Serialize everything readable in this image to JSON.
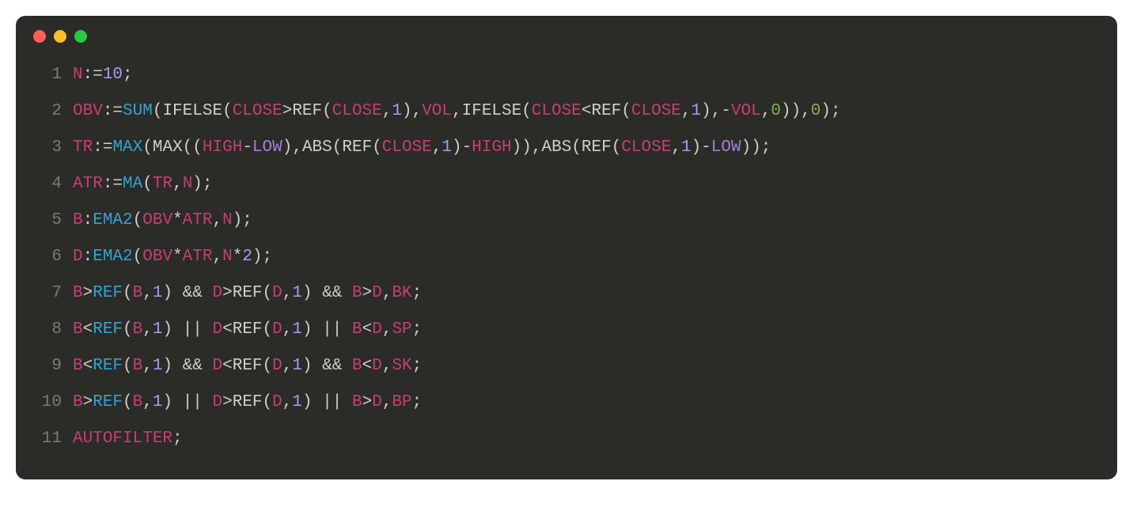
{
  "window": {
    "dots": [
      "red",
      "yellow",
      "green"
    ]
  },
  "lines": [
    {
      "n": "1",
      "tokens": [
        {
          "c": "t-var",
          "t": "N"
        },
        {
          "c": "t-punct",
          "t": ":="
        },
        {
          "c": "t-num",
          "t": "10"
        },
        {
          "c": "t-punct",
          "t": ";"
        }
      ]
    },
    {
      "n": "2",
      "tokens": [
        {
          "c": "t-var",
          "t": "OBV"
        },
        {
          "c": "t-punct",
          "t": ":="
        },
        {
          "c": "t-func",
          "t": "SUM"
        },
        {
          "c": "t-punct",
          "t": "("
        },
        {
          "c": "t-default",
          "t": "IFELSE"
        },
        {
          "c": "t-punct",
          "t": "("
        },
        {
          "c": "t-var",
          "t": "CLOSE"
        },
        {
          "c": "t-punct",
          "t": ">"
        },
        {
          "c": "t-default",
          "t": "REF"
        },
        {
          "c": "t-punct",
          "t": "("
        },
        {
          "c": "t-var",
          "t": "CLOSE"
        },
        {
          "c": "t-punct",
          "t": ","
        },
        {
          "c": "t-num",
          "t": "1"
        },
        {
          "c": "t-punct",
          "t": "),"
        },
        {
          "c": "t-var",
          "t": "VOL"
        },
        {
          "c": "t-punct",
          "t": ","
        },
        {
          "c": "t-default",
          "t": "IFELSE"
        },
        {
          "c": "t-punct",
          "t": "("
        },
        {
          "c": "t-var",
          "t": "CLOSE"
        },
        {
          "c": "t-punct",
          "t": "<"
        },
        {
          "c": "t-default",
          "t": "REF"
        },
        {
          "c": "t-punct",
          "t": "("
        },
        {
          "c": "t-var",
          "t": "CLOSE"
        },
        {
          "c": "t-punct",
          "t": ","
        },
        {
          "c": "t-num",
          "t": "1"
        },
        {
          "c": "t-punct",
          "t": "),-"
        },
        {
          "c": "t-var",
          "t": "VOL"
        },
        {
          "c": "t-punct",
          "t": ","
        },
        {
          "c": "t-green",
          "t": "0"
        },
        {
          "c": "t-punct",
          "t": ")),"
        },
        {
          "c": "t-green",
          "t": "0"
        },
        {
          "c": "t-punct",
          "t": ");"
        }
      ]
    },
    {
      "n": "3",
      "tokens": [
        {
          "c": "t-var",
          "t": "TR"
        },
        {
          "c": "t-punct",
          "t": ":="
        },
        {
          "c": "t-func",
          "t": "MAX"
        },
        {
          "c": "t-punct",
          "t": "("
        },
        {
          "c": "t-default",
          "t": "MAX"
        },
        {
          "c": "t-punct",
          "t": "(("
        },
        {
          "c": "t-var",
          "t": "HIGH"
        },
        {
          "c": "t-punct",
          "t": "-"
        },
        {
          "c": "t-kw",
          "t": "LOW"
        },
        {
          "c": "t-punct",
          "t": "),"
        },
        {
          "c": "t-default",
          "t": "ABS"
        },
        {
          "c": "t-punct",
          "t": "("
        },
        {
          "c": "t-default",
          "t": "REF"
        },
        {
          "c": "t-punct",
          "t": "("
        },
        {
          "c": "t-var",
          "t": "CLOSE"
        },
        {
          "c": "t-punct",
          "t": ","
        },
        {
          "c": "t-num",
          "t": "1"
        },
        {
          "c": "t-punct",
          "t": ")-"
        },
        {
          "c": "t-var",
          "t": "HIGH"
        },
        {
          "c": "t-punct",
          "t": ")),"
        },
        {
          "c": "t-default",
          "t": "ABS"
        },
        {
          "c": "t-punct",
          "t": "("
        },
        {
          "c": "t-default",
          "t": "REF"
        },
        {
          "c": "t-punct",
          "t": "("
        },
        {
          "c": "t-var",
          "t": "CLOSE"
        },
        {
          "c": "t-punct",
          "t": ","
        },
        {
          "c": "t-num",
          "t": "1"
        },
        {
          "c": "t-punct",
          "t": ")-"
        },
        {
          "c": "t-kw",
          "t": "LOW"
        },
        {
          "c": "t-punct",
          "t": "));"
        }
      ]
    },
    {
      "n": "4",
      "tokens": [
        {
          "c": "t-var",
          "t": "ATR"
        },
        {
          "c": "t-punct",
          "t": ":="
        },
        {
          "c": "t-func",
          "t": "MA"
        },
        {
          "c": "t-punct",
          "t": "("
        },
        {
          "c": "t-var",
          "t": "TR"
        },
        {
          "c": "t-punct",
          "t": ","
        },
        {
          "c": "t-var",
          "t": "N"
        },
        {
          "c": "t-punct",
          "t": ");"
        }
      ]
    },
    {
      "n": "5",
      "tokens": [
        {
          "c": "t-var",
          "t": "B"
        },
        {
          "c": "t-punct",
          "t": ":"
        },
        {
          "c": "t-func",
          "t": "EMA2"
        },
        {
          "c": "t-punct",
          "t": "("
        },
        {
          "c": "t-var",
          "t": "OBV"
        },
        {
          "c": "t-punct",
          "t": "*"
        },
        {
          "c": "t-var",
          "t": "ATR"
        },
        {
          "c": "t-punct",
          "t": ","
        },
        {
          "c": "t-var",
          "t": "N"
        },
        {
          "c": "t-punct",
          "t": ");"
        }
      ]
    },
    {
      "n": "6",
      "tokens": [
        {
          "c": "t-var",
          "t": "D"
        },
        {
          "c": "t-punct",
          "t": ":"
        },
        {
          "c": "t-func",
          "t": "EMA2"
        },
        {
          "c": "t-punct",
          "t": "("
        },
        {
          "c": "t-var",
          "t": "OBV"
        },
        {
          "c": "t-punct",
          "t": "*"
        },
        {
          "c": "t-var",
          "t": "ATR"
        },
        {
          "c": "t-punct",
          "t": ","
        },
        {
          "c": "t-var",
          "t": "N"
        },
        {
          "c": "t-punct",
          "t": "*"
        },
        {
          "c": "t-num",
          "t": "2"
        },
        {
          "c": "t-punct",
          "t": ");"
        }
      ]
    },
    {
      "n": "7",
      "tokens": [
        {
          "c": "t-var",
          "t": "B"
        },
        {
          "c": "t-punct",
          "t": ">"
        },
        {
          "c": "t-func",
          "t": "REF"
        },
        {
          "c": "t-punct",
          "t": "("
        },
        {
          "c": "t-var",
          "t": "B"
        },
        {
          "c": "t-punct",
          "t": ","
        },
        {
          "c": "t-num",
          "t": "1"
        },
        {
          "c": "t-punct",
          "t": ") "
        },
        {
          "c": "t-punct",
          "t": "&& "
        },
        {
          "c": "t-var",
          "t": "D"
        },
        {
          "c": "t-punct",
          "t": ">"
        },
        {
          "c": "t-default",
          "t": "REF"
        },
        {
          "c": "t-punct",
          "t": "("
        },
        {
          "c": "t-var",
          "t": "D"
        },
        {
          "c": "t-punct",
          "t": ","
        },
        {
          "c": "t-num",
          "t": "1"
        },
        {
          "c": "t-punct",
          "t": ") "
        },
        {
          "c": "t-punct",
          "t": "&& "
        },
        {
          "c": "t-var",
          "t": "B"
        },
        {
          "c": "t-punct",
          "t": ">"
        },
        {
          "c": "t-var",
          "t": "D"
        },
        {
          "c": "t-punct",
          "t": ","
        },
        {
          "c": "t-var",
          "t": "BK"
        },
        {
          "c": "t-punct",
          "t": ";"
        }
      ]
    },
    {
      "n": "8",
      "tokens": [
        {
          "c": "t-var",
          "t": "B"
        },
        {
          "c": "t-punct",
          "t": "<"
        },
        {
          "c": "t-func",
          "t": "REF"
        },
        {
          "c": "t-punct",
          "t": "("
        },
        {
          "c": "t-var",
          "t": "B"
        },
        {
          "c": "t-punct",
          "t": ","
        },
        {
          "c": "t-num",
          "t": "1"
        },
        {
          "c": "t-punct",
          "t": ") "
        },
        {
          "c": "t-punct",
          "t": "|| "
        },
        {
          "c": "t-var",
          "t": "D"
        },
        {
          "c": "t-punct",
          "t": "<"
        },
        {
          "c": "t-default",
          "t": "REF"
        },
        {
          "c": "t-punct",
          "t": "("
        },
        {
          "c": "t-var",
          "t": "D"
        },
        {
          "c": "t-punct",
          "t": ","
        },
        {
          "c": "t-num",
          "t": "1"
        },
        {
          "c": "t-punct",
          "t": ") "
        },
        {
          "c": "t-punct",
          "t": "|| "
        },
        {
          "c": "t-var",
          "t": "B"
        },
        {
          "c": "t-punct",
          "t": "<"
        },
        {
          "c": "t-var",
          "t": "D"
        },
        {
          "c": "t-punct",
          "t": ","
        },
        {
          "c": "t-var",
          "t": "SP"
        },
        {
          "c": "t-punct",
          "t": ";"
        }
      ]
    },
    {
      "n": "9",
      "tokens": [
        {
          "c": "t-var",
          "t": "B"
        },
        {
          "c": "t-punct",
          "t": "<"
        },
        {
          "c": "t-func",
          "t": "REF"
        },
        {
          "c": "t-punct",
          "t": "("
        },
        {
          "c": "t-var",
          "t": "B"
        },
        {
          "c": "t-punct",
          "t": ","
        },
        {
          "c": "t-num",
          "t": "1"
        },
        {
          "c": "t-punct",
          "t": ") "
        },
        {
          "c": "t-punct",
          "t": "&& "
        },
        {
          "c": "t-var",
          "t": "D"
        },
        {
          "c": "t-punct",
          "t": "<"
        },
        {
          "c": "t-default",
          "t": "REF"
        },
        {
          "c": "t-punct",
          "t": "("
        },
        {
          "c": "t-var",
          "t": "D"
        },
        {
          "c": "t-punct",
          "t": ","
        },
        {
          "c": "t-num",
          "t": "1"
        },
        {
          "c": "t-punct",
          "t": ") "
        },
        {
          "c": "t-punct",
          "t": "&& "
        },
        {
          "c": "t-var",
          "t": "B"
        },
        {
          "c": "t-punct",
          "t": "<"
        },
        {
          "c": "t-var",
          "t": "D"
        },
        {
          "c": "t-punct",
          "t": ","
        },
        {
          "c": "t-var",
          "t": "SK"
        },
        {
          "c": "t-punct",
          "t": ";"
        }
      ]
    },
    {
      "n": "10",
      "tokens": [
        {
          "c": "t-var",
          "t": "B"
        },
        {
          "c": "t-punct",
          "t": ">"
        },
        {
          "c": "t-func",
          "t": "REF"
        },
        {
          "c": "t-punct",
          "t": "("
        },
        {
          "c": "t-var",
          "t": "B"
        },
        {
          "c": "t-punct",
          "t": ","
        },
        {
          "c": "t-num",
          "t": "1"
        },
        {
          "c": "t-punct",
          "t": ") "
        },
        {
          "c": "t-punct",
          "t": "|| "
        },
        {
          "c": "t-var",
          "t": "D"
        },
        {
          "c": "t-punct",
          "t": ">"
        },
        {
          "c": "t-default",
          "t": "REF"
        },
        {
          "c": "t-punct",
          "t": "("
        },
        {
          "c": "t-var",
          "t": "D"
        },
        {
          "c": "t-punct",
          "t": ","
        },
        {
          "c": "t-num",
          "t": "1"
        },
        {
          "c": "t-punct",
          "t": ") "
        },
        {
          "c": "t-punct",
          "t": "|| "
        },
        {
          "c": "t-var",
          "t": "B"
        },
        {
          "c": "t-punct",
          "t": ">"
        },
        {
          "c": "t-var",
          "t": "D"
        },
        {
          "c": "t-punct",
          "t": ","
        },
        {
          "c": "t-var",
          "t": "BP"
        },
        {
          "c": "t-punct",
          "t": ";"
        }
      ]
    },
    {
      "n": "11",
      "tokens": [
        {
          "c": "t-var",
          "t": "AUTOFILTER"
        },
        {
          "c": "t-punct",
          "t": ";"
        }
      ]
    }
  ]
}
